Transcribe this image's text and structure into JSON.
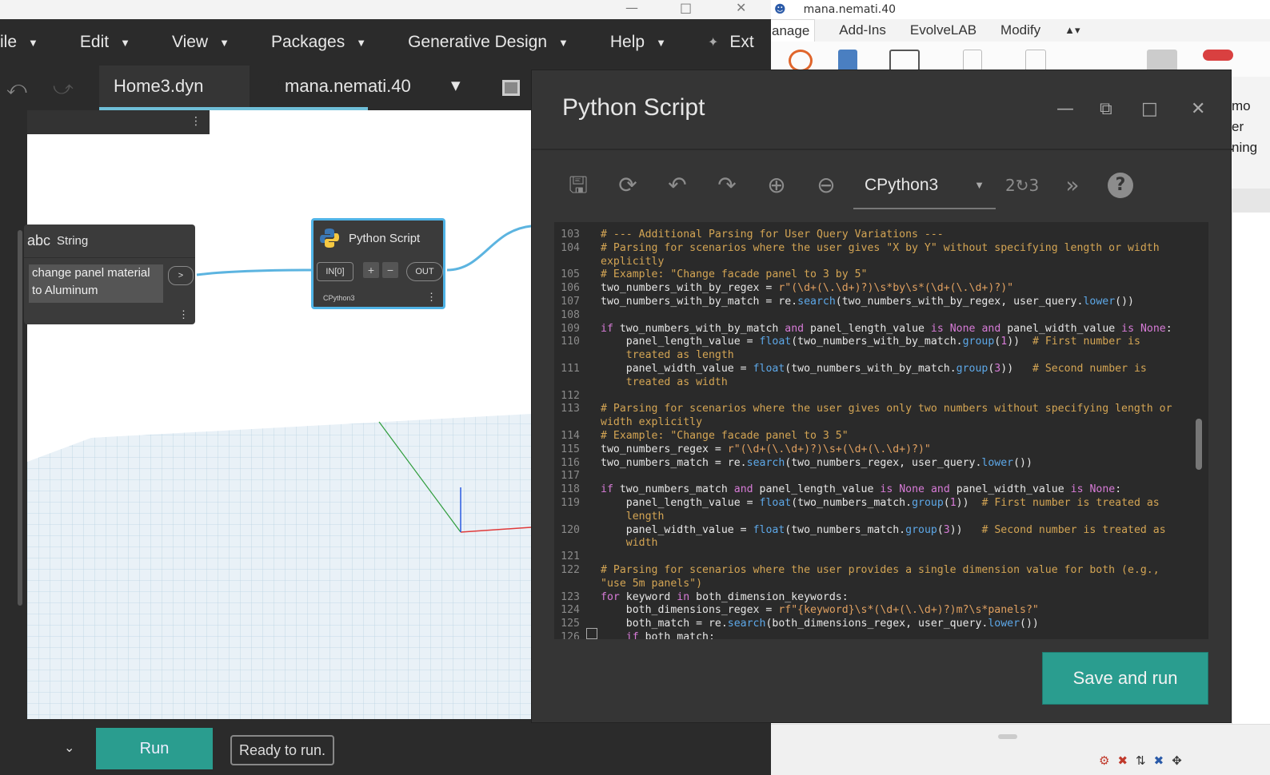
{
  "revit": {
    "titlebar_user": "mana.nemati.40",
    "ribbon_tabs": [
      "anage",
      "Add-Ins",
      "EvolveLAB",
      "Modify"
    ],
    "side_text": [
      "mo",
      "er",
      "ning"
    ]
  },
  "dynamo": {
    "menu": [
      "ile",
      "Edit",
      "View",
      "Packages",
      "Generative Design",
      "Help",
      "Ext"
    ],
    "tabs": {
      "home": "Home3.dyn",
      "user": "mana.nemati.40"
    },
    "nodes": {
      "string": {
        "title": "String",
        "prefix": "abc",
        "value": "change panel material to Aluminum",
        "port": ">"
      },
      "python": {
        "title": "Python Script",
        "input": "IN[0]",
        "add": "+",
        "remove": "−",
        "output": "OUT",
        "engine": "CPython3"
      }
    },
    "run_button": "Run",
    "status": "Ready to run."
  },
  "python_editor": {
    "title": "Python Script",
    "engine": "CPython3",
    "save_run": "Save and run",
    "lines": [
      {
        "n": "103",
        "code": "# --- Additional Parsing for User Query Variations ---"
      },
      {
        "n": "104",
        "code": "# Parsing for scenarios where the user gives \"X by Y\" without specifying length or width"
      },
      {
        "n": "",
        "code": "explicitly"
      },
      {
        "n": "105",
        "code": "# Example: \"Change facade panel to 3 by 5\""
      },
      {
        "n": "106",
        "code": "two_numbers_with_by_regex = r\"(\\d+(\\.\\d+)?)\\s*by\\s*(\\d+(\\.\\d+)?)\""
      },
      {
        "n": "107",
        "code": "two_numbers_with_by_match = re.search(two_numbers_with_by_regex, user_query.lower())"
      },
      {
        "n": "108",
        "code": ""
      },
      {
        "n": "109",
        "code": "if two_numbers_with_by_match and panel_length_value is None and panel_width_value is None:"
      },
      {
        "n": "110",
        "code": "    panel_length_value = float(two_numbers_with_by_match.group(1))  # First number is"
      },
      {
        "n": "",
        "code": "    treated as length"
      },
      {
        "n": "111",
        "code": "    panel_width_value = float(two_numbers_with_by_match.group(3))   # Second number is"
      },
      {
        "n": "",
        "code": "    treated as width"
      },
      {
        "n": "112",
        "code": ""
      },
      {
        "n": "113",
        "code": "# Parsing for scenarios where the user gives only two numbers without specifying length or"
      },
      {
        "n": "",
        "code": "width explicitly"
      },
      {
        "n": "114",
        "code": "# Example: \"Change facade panel to 3 5\""
      },
      {
        "n": "115",
        "code": "two_numbers_regex = r\"(\\d+(\\.\\d+)?)\\s+(\\d+(\\.\\d+)?)\""
      },
      {
        "n": "116",
        "code": "two_numbers_match = re.search(two_numbers_regex, user_query.lower())"
      },
      {
        "n": "117",
        "code": ""
      },
      {
        "n": "118",
        "code": "if two_numbers_match and panel_length_value is None and panel_width_value is None:"
      },
      {
        "n": "119",
        "code": "    panel_length_value = float(two_numbers_match.group(1))  # First number is treated as"
      },
      {
        "n": "",
        "code": "    length"
      },
      {
        "n": "120",
        "code": "    panel_width_value = float(two_numbers_match.group(3))   # Second number is treated as"
      },
      {
        "n": "",
        "code": "    width"
      },
      {
        "n": "121",
        "code": ""
      },
      {
        "n": "122",
        "code": "# Parsing for scenarios where the user provides a single dimension value for both (e.g.,"
      },
      {
        "n": "",
        "code": "\"use 5m panels\")"
      },
      {
        "n": "123",
        "code": "for keyword in both_dimension_keywords:"
      },
      {
        "n": "124",
        "code": "    both_dimensions_regex = rf\"{keyword}\\s*(\\d+(\\.\\d+)?)m?\\s*panels?\""
      },
      {
        "n": "125",
        "code": "    both_match = re.search(both_dimensions_regex, user_query.lower())"
      },
      {
        "n": "126",
        "code": "    if both_match:"
      }
    ]
  },
  "colors": {
    "accent": "#2a9d8f",
    "node_selected": "#4fb3e6",
    "comment": "#d4a554",
    "keyword": "#d77bd7",
    "function": "#5da8e8"
  }
}
